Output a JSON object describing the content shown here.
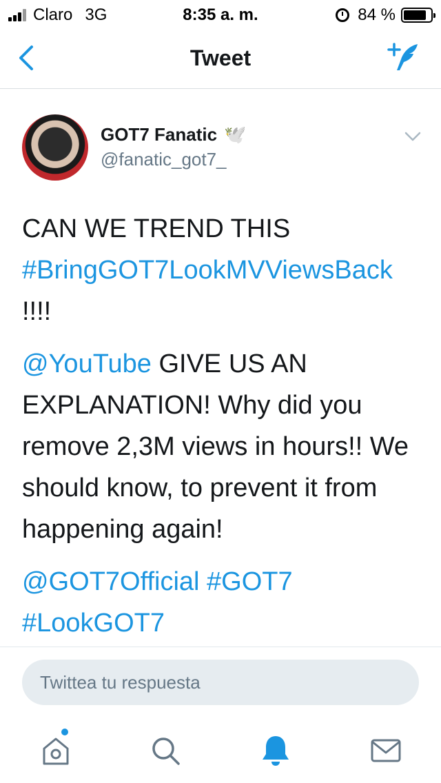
{
  "status_bar": {
    "carrier": "Claro",
    "network": "3G",
    "time": "8:35 a. m.",
    "battery": "84 %",
    "battery_level": 0.84
  },
  "nav": {
    "title": "Tweet",
    "back_icon": "chevron-left-icon",
    "compose_icon": "compose-tweet-icon"
  },
  "tweet": {
    "author_name": "GOT7 Fanatic",
    "author_badge": "🕊️",
    "author_handle": "@fanatic_got7_",
    "paragraphs": [
      {
        "parts": [
          {
            "text": "CAN WE TREND THIS ",
            "link": false
          },
          {
            "text": "#BringGOT7LookMVViewsBack",
            "link": true
          },
          {
            "text": " !!!!",
            "link": false
          }
        ]
      },
      {
        "parts": [
          {
            "text": "@YouTube",
            "link": true
          },
          {
            "text": " GIVE US AN EXPLANATION! Why did you remove 2,3M views in hours!! We should know, to prevent it from happening again!",
            "link": false
          }
        ]
      },
      {
        "parts": [
          {
            "text": "@GOT7Official",
            "link": true
          },
          {
            "text": " ",
            "link": false
          },
          {
            "text": "#GOT7",
            "link": true
          },
          {
            "text": " ",
            "link": false
          },
          {
            "text": "#LookGOT7",
            "link": true
          }
        ]
      }
    ]
  },
  "reply": {
    "placeholder": "Twittea tu respuesta"
  },
  "tabs": [
    {
      "name": "home",
      "icon": "home-icon",
      "badge_dot": true
    },
    {
      "name": "search",
      "icon": "search-icon",
      "badge_dot": false
    },
    {
      "name": "notifications",
      "icon": "bell-icon",
      "badge_dot": false,
      "active": true
    },
    {
      "name": "messages",
      "icon": "mail-icon",
      "badge_dot": false
    }
  ],
  "colors": {
    "accent": "#1b95e0",
    "text": "#14171a",
    "secondary": "#657786",
    "reply_bg": "#e6ecf0"
  }
}
